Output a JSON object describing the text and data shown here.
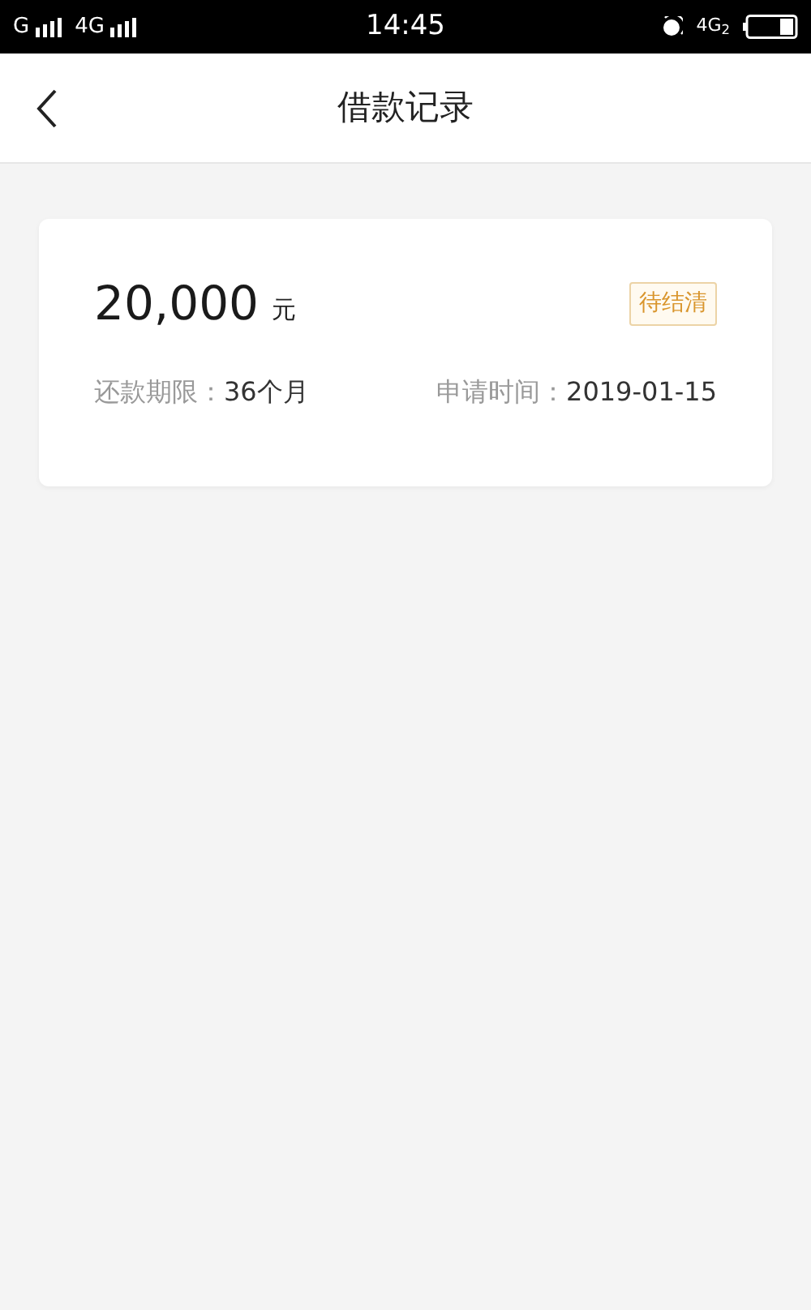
{
  "status_bar": {
    "carrier_1": "G",
    "carrier_2": "4G",
    "time": "14:45",
    "network": "4G$_{2}$"
  },
  "header": {
    "title": "借款记录"
  },
  "records": [
    {
      "amount": "20,000",
      "unit": "元",
      "status": "待结清",
      "term_label": "还款期限：",
      "term": "36个月",
      "date_label": "申请时间：",
      "date": "2019-01-15"
    }
  ]
}
